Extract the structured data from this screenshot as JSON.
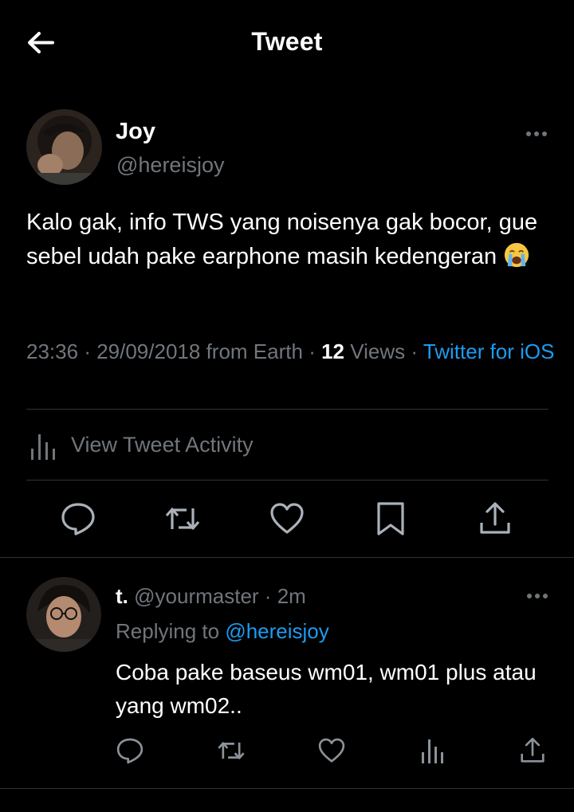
{
  "header": {
    "title": "Tweet",
    "back_icon": "arrow-left-icon"
  },
  "tweet": {
    "author_name": "Joy",
    "author_handle": "@hereisjoy",
    "text": "Kalo gak, info TWS yang noisenya gak bocor, gue sebel udah pake earphone masih kedengeran",
    "emoji": "loudly-crying-face",
    "time": "23:36",
    "date": "29/09/2018",
    "location": "from Earth",
    "views_count": "12",
    "views_label": "Views",
    "source": "Twitter for iOS",
    "activity_label": "View Tweet Activity",
    "actions": [
      "reply-icon",
      "retweet-icon",
      "like-icon",
      "bookmark-icon",
      "share-icon"
    ]
  },
  "reply": {
    "author_name": "t.",
    "author_handle": "@yourmaster",
    "time_ago": "2m",
    "replying_label": "Replying to",
    "replying_to": "@hereisjoy",
    "text": "Coba pake baseus wm01, wm01 plus atau yang wm02..",
    "actions": [
      "reply-icon",
      "retweet-icon",
      "like-icon",
      "analytics-icon",
      "share-icon"
    ]
  },
  "colors": {
    "background": "#000000",
    "text": "#ffffff",
    "muted": "#71767b",
    "accent": "#1d9bf0",
    "divider": "#2f3336"
  }
}
